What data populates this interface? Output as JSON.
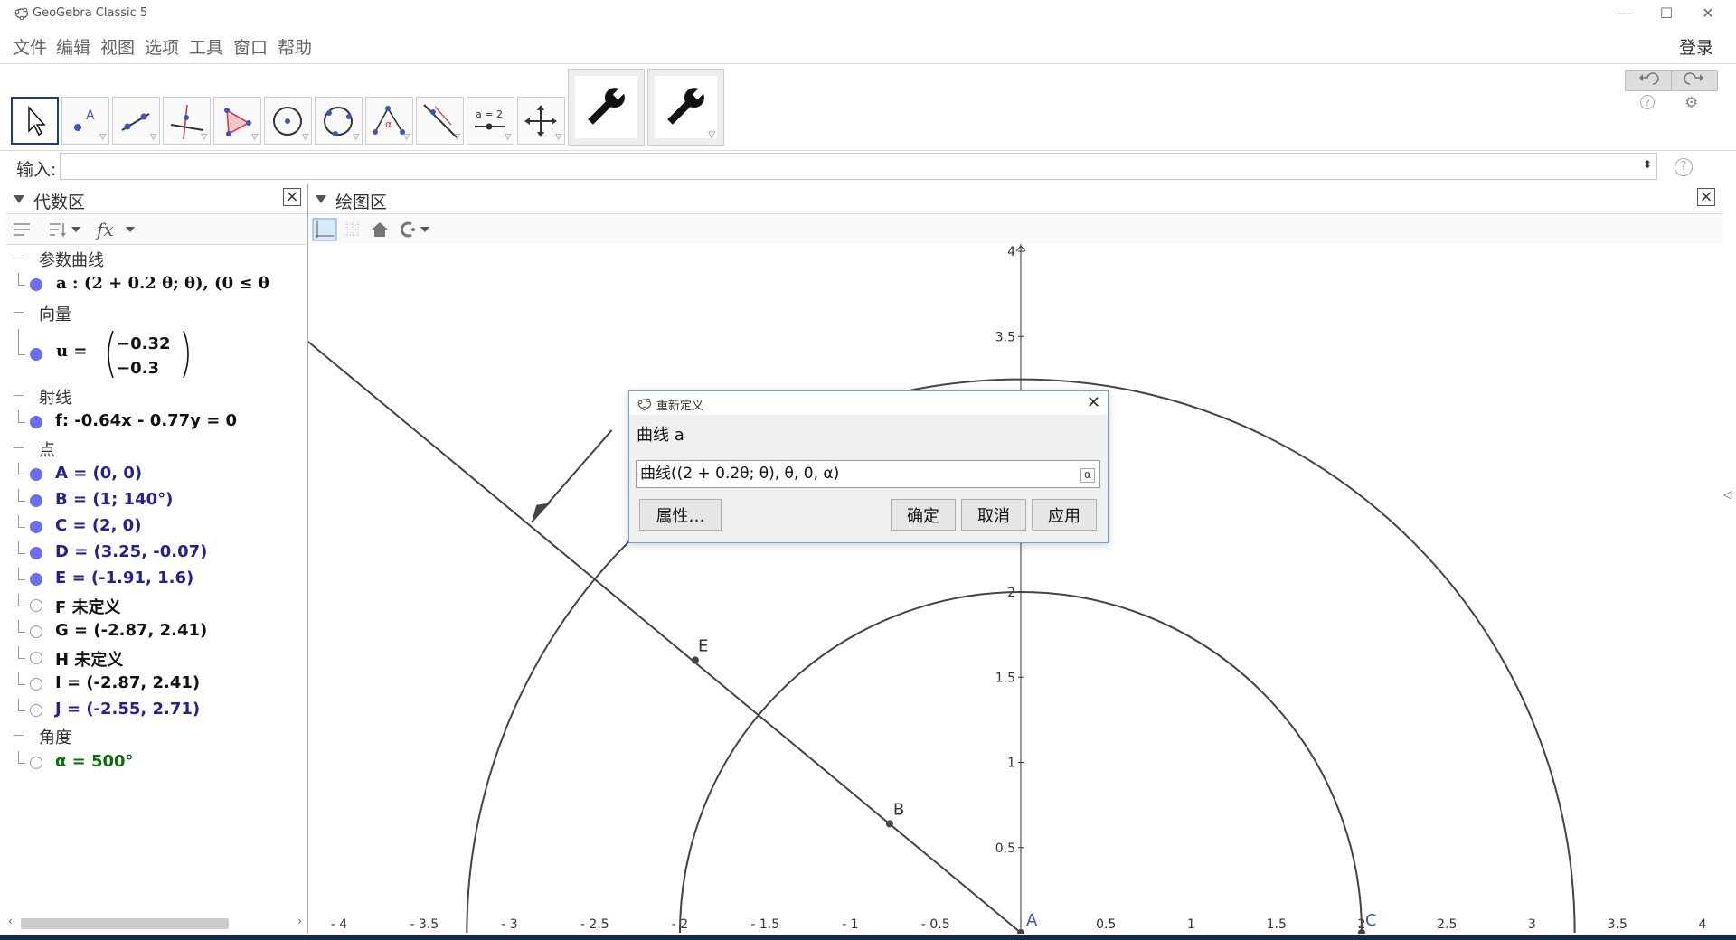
{
  "window": {
    "title": "GeoGebra Classic 5"
  },
  "menu": {
    "items": [
      "文件",
      "编辑",
      "视图",
      "选项",
      "工具",
      "窗口",
      "帮助"
    ],
    "login": "登录"
  },
  "toolbar": {
    "tools": [
      "move",
      "point",
      "line",
      "perpendicular",
      "polygon",
      "circle-center",
      "circle-3pt",
      "angle",
      "reflect",
      "slider",
      "move-view"
    ]
  },
  "input": {
    "label": "输入:",
    "value": ""
  },
  "algebra": {
    "title": "代数区",
    "groups": [
      {
        "label": "参数曲线",
        "items": [
          {
            "text": "a : (2 + 0.2 θ; θ),   (0 ≤ θ",
            "shown": true,
            "color": "black"
          }
        ]
      },
      {
        "label": "向量",
        "items": [
          {
            "text": "u = ",
            "vector": [
              "−0.32",
              "−0.3"
            ],
            "shown": true,
            "color": "black"
          }
        ]
      },
      {
        "label": "射线",
        "items": [
          {
            "text": "f: -0.64x - 0.77y = 0",
            "shown": true,
            "color": "black"
          }
        ]
      },
      {
        "label": "点",
        "items": [
          {
            "text": "A = (0, 0)",
            "shown": true,
            "color": "blue"
          },
          {
            "text": "B = (1; 140°)",
            "shown": true,
            "color": "blue"
          },
          {
            "text": "C = (2, 0)",
            "shown": true,
            "color": "blue"
          },
          {
            "text": "D = (3.25, -0.07)",
            "shown": true,
            "color": "blue"
          },
          {
            "text": "E = (-1.91, 1.6)",
            "shown": true,
            "color": "blue"
          },
          {
            "text": "F 未定义",
            "shown": false,
            "color": "black"
          },
          {
            "text": "G = (-2.87, 2.41)",
            "shown": false,
            "color": "black"
          },
          {
            "text": "H 未定义",
            "shown": false,
            "color": "black"
          },
          {
            "text": "I = (-2.87, 2.41)",
            "shown": false,
            "color": "black"
          },
          {
            "text": "J = (-2.55, 2.71)",
            "shown": false,
            "color": "blue"
          }
        ]
      },
      {
        "label": "角度",
        "items": [
          {
            "text": "α = 500°",
            "shown": false,
            "color": "green"
          }
        ]
      }
    ]
  },
  "graphics": {
    "title": "绘图区",
    "x_ticks": [
      "- 4",
      "- 3.5",
      "- 3",
      "- 2.5",
      "- 2",
      "- 1.5",
      "- 1",
      "- 0.5",
      "0.5",
      "1",
      "1.5",
      "2",
      "2.5",
      "3",
      "3.5",
      "4"
    ],
    "y_ticks": [
      "0.5",
      "1",
      "1.5",
      "2",
      "2.5",
      "3",
      "3.5",
      "4"
    ],
    "point_labels": {
      "A": "A",
      "B": "B",
      "C": "C",
      "E": "E"
    }
  },
  "dialog": {
    "title": "重新定义",
    "caption": "曲线 a",
    "value": "曲线((2 + 0.2θ; θ), θ, 0, α)",
    "alpha_button": "α",
    "buttons": {
      "properties": "属性…",
      "ok": "确定",
      "cancel": "取消",
      "apply": "应用"
    }
  },
  "colors": {
    "point": "#6a6ef0",
    "accent": "#1f3a86",
    "text_blue": "#23238e",
    "text_green": "#0a6e0a"
  }
}
